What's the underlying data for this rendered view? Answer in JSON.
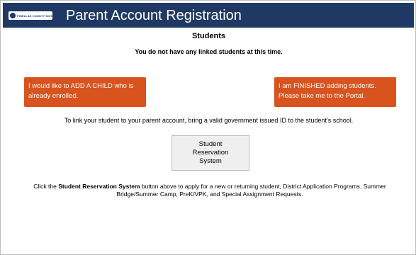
{
  "header": {
    "logo_text": "PINELLAS COUNTY SCHOOLS",
    "title": "Parent Account Registration",
    "background_color": "#1f3864"
  },
  "main": {
    "heading": "Students",
    "notice": "You do not have any linked students at this time.",
    "add_child_button": "I would like to ADD A CHILD who is already enrolled.",
    "finished_button": "I am FINISHED adding students. Please take me to the Portal.",
    "info_text": "To link your student to your parent account, bring a valid government issued ID to the student's school.",
    "reservation_button": "Student Reservation System",
    "bottom_prefix": "Click the ",
    "bottom_bold": "Student Reservation System",
    "bottom_suffix": " button above to apply for a new or returning student, District Application Programs, Summer Bridge/Summer Camp, PreK/VPK, and Special Assignment Requests.",
    "accent_color": "#d9531e"
  }
}
